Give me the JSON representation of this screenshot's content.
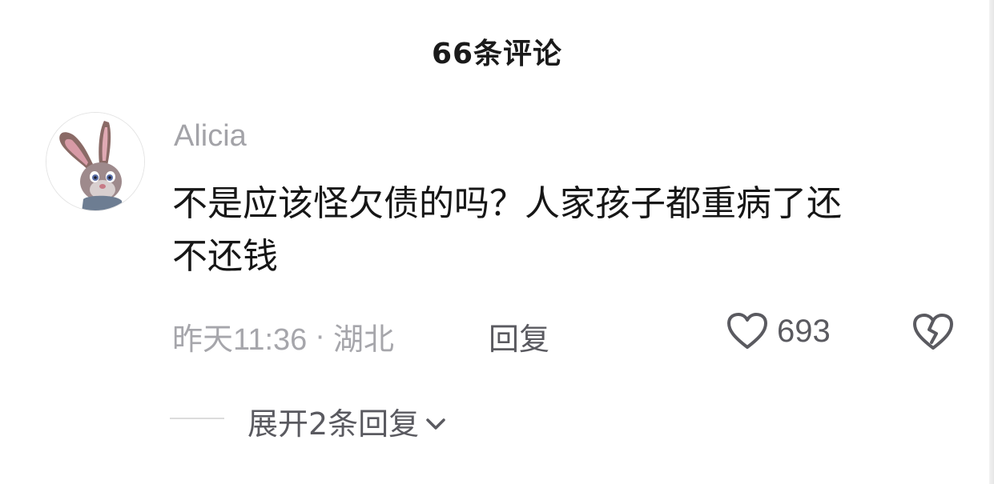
{
  "header": {
    "title": "66条评论"
  },
  "comment": {
    "username": "Alicia",
    "text_line1": "不是应该怪欠债的吗？人家孩子都重病了还",
    "text_line2": "不还钱",
    "time": "昨天11:36",
    "separator": "·",
    "location": "湖北",
    "reply_label": "回复",
    "like_count": "693",
    "expand_label": "展开2条回复"
  },
  "icons": {
    "avatar": "rabbit-avatar-icon",
    "like": "heart-outline-icon",
    "dislike": "broken-heart-icon",
    "expand": "chevron-down-icon"
  }
}
